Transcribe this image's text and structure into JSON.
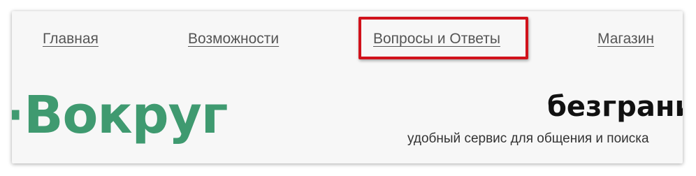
{
  "nav": {
    "home": "Главная",
    "features": "Возможности",
    "qa": "Вопросы и Ответы",
    "shop": "Магазин"
  },
  "logo": {
    "text": "Вокруг"
  },
  "tagline": {
    "headline": "безграни",
    "subline": "удобный сервис для общения и поиска"
  },
  "colors": {
    "brand_green": "#3f9a70",
    "highlight_red": "#d1121b"
  }
}
